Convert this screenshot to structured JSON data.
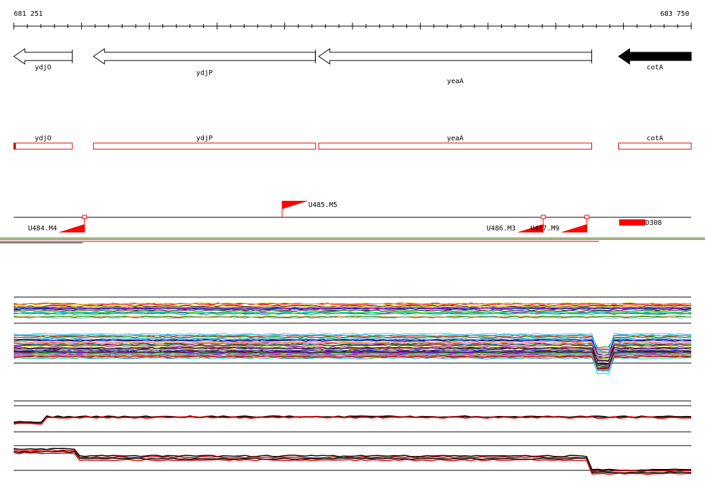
{
  "ruler": {
    "start_label": "681 251",
    "end_label": "683 750",
    "start": 681251,
    "end": 683750
  },
  "colors": {
    "gene_outline": "#000000",
    "gene_filled": "#000000",
    "cds_box": "#dd0000",
    "marker": "#ff0000",
    "track_line": "#000000",
    "separator_green": "#00aa00"
  },
  "genes": [
    {
      "name": "ydjO",
      "start": 681251,
      "end": 681467,
      "strand": "-",
      "filled": false
    },
    {
      "name": "ydjP",
      "start": 681545,
      "end": 682364,
      "strand": "-",
      "filled": false
    },
    {
      "name": "yeaA",
      "start": 682376,
      "end": 683383,
      "strand": "-",
      "filled": false
    },
    {
      "name": "cotA",
      "start": 683482,
      "end": 683750,
      "strand": "-",
      "filled": true
    }
  ],
  "cds": [
    {
      "name": "ydjO",
      "start": 681251,
      "end": 681467
    },
    {
      "name": "ydjP",
      "start": 681545,
      "end": 682364
    },
    {
      "name": "yeaA",
      "start": 682376,
      "end": 683383
    },
    {
      "name": "cotA",
      "start": 683482,
      "end": 683750
    }
  ],
  "markers": [
    {
      "label": "U484.M4",
      "pos": 681512,
      "type": "down-left"
    },
    {
      "label": "U485.M5",
      "pos": 682241,
      "type": "up-right"
    },
    {
      "label": "U486.M3",
      "pos": 683204,
      "type": "down-left"
    },
    {
      "label": "U487.M9",
      "pos": 683365,
      "type": "down-left"
    },
    {
      "label": "D308",
      "pos": 683484,
      "type": "bar"
    }
  ]
}
